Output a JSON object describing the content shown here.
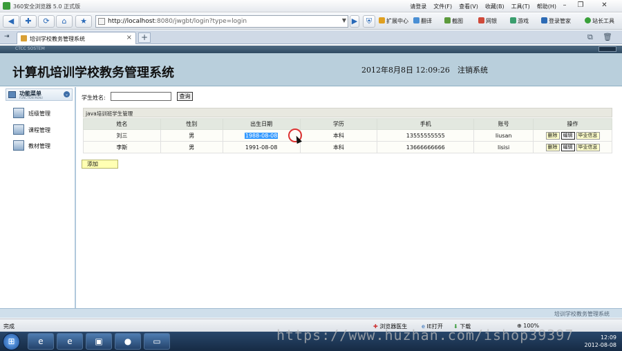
{
  "browser": {
    "title": "360安全浏览器 5.0 正式版",
    "menus": [
      "请登录",
      "文件(F)",
      "查看(V)",
      "收藏(B)",
      "工具(T)",
      "帮助(H)"
    ],
    "url_host": "http://localhost",
    "url_rest": ":8080/jwgbt/login?type=login",
    "toolbar": [
      "扩展中心",
      "翻译",
      "截图",
      "网银",
      "游戏",
      "登录管家",
      "站长工具"
    ],
    "tab_label": "培训学校教务管理系统",
    "tab_close": "×",
    "new_tab": "+",
    "status_left": "完成",
    "status_items": [
      "浏览器医生",
      "IE打开",
      "下载",
      "100%"
    ],
    "clock_time": "12:09",
    "clock_date": "2012-08-08",
    "watermark": "https://www.huzhan.com/ishop39397"
  },
  "app": {
    "strip_text": "CTCC SOSTEM",
    "system_title": "计算机培训学校教务管理系统",
    "datetime": "2012年8月8日  12:09:26",
    "logout": "注销系统",
    "sidebar": {
      "title": "功能菜单",
      "subtitle": "FUNCTION MENU",
      "items": [
        {
          "label": "班级管理"
        },
        {
          "label": "课程管理"
        },
        {
          "label": "教材管理"
        }
      ]
    },
    "search": {
      "label": "学生姓名:",
      "value": "",
      "button": "查询"
    },
    "table_title": "java培训班学生管理",
    "columns": [
      "姓名",
      "性别",
      "出生日期",
      "学历",
      "手机",
      "账号",
      "操作"
    ],
    "rows": [
      {
        "name": "刘三",
        "gender": "男",
        "birth": "1988-08-08",
        "edu": "本科",
        "phone": "13555555555",
        "account": "liusan"
      },
      {
        "name": "李斯",
        "gender": "男",
        "birth": "1991-08-08",
        "edu": "本科",
        "phone": "13666666666",
        "account": "lisisi"
      }
    ],
    "ops": {
      "delete": "删除",
      "edit": "编辑",
      "graduate": "毕业信息"
    },
    "add_button": "添加",
    "footer": "培训学校教务管理系统"
  }
}
